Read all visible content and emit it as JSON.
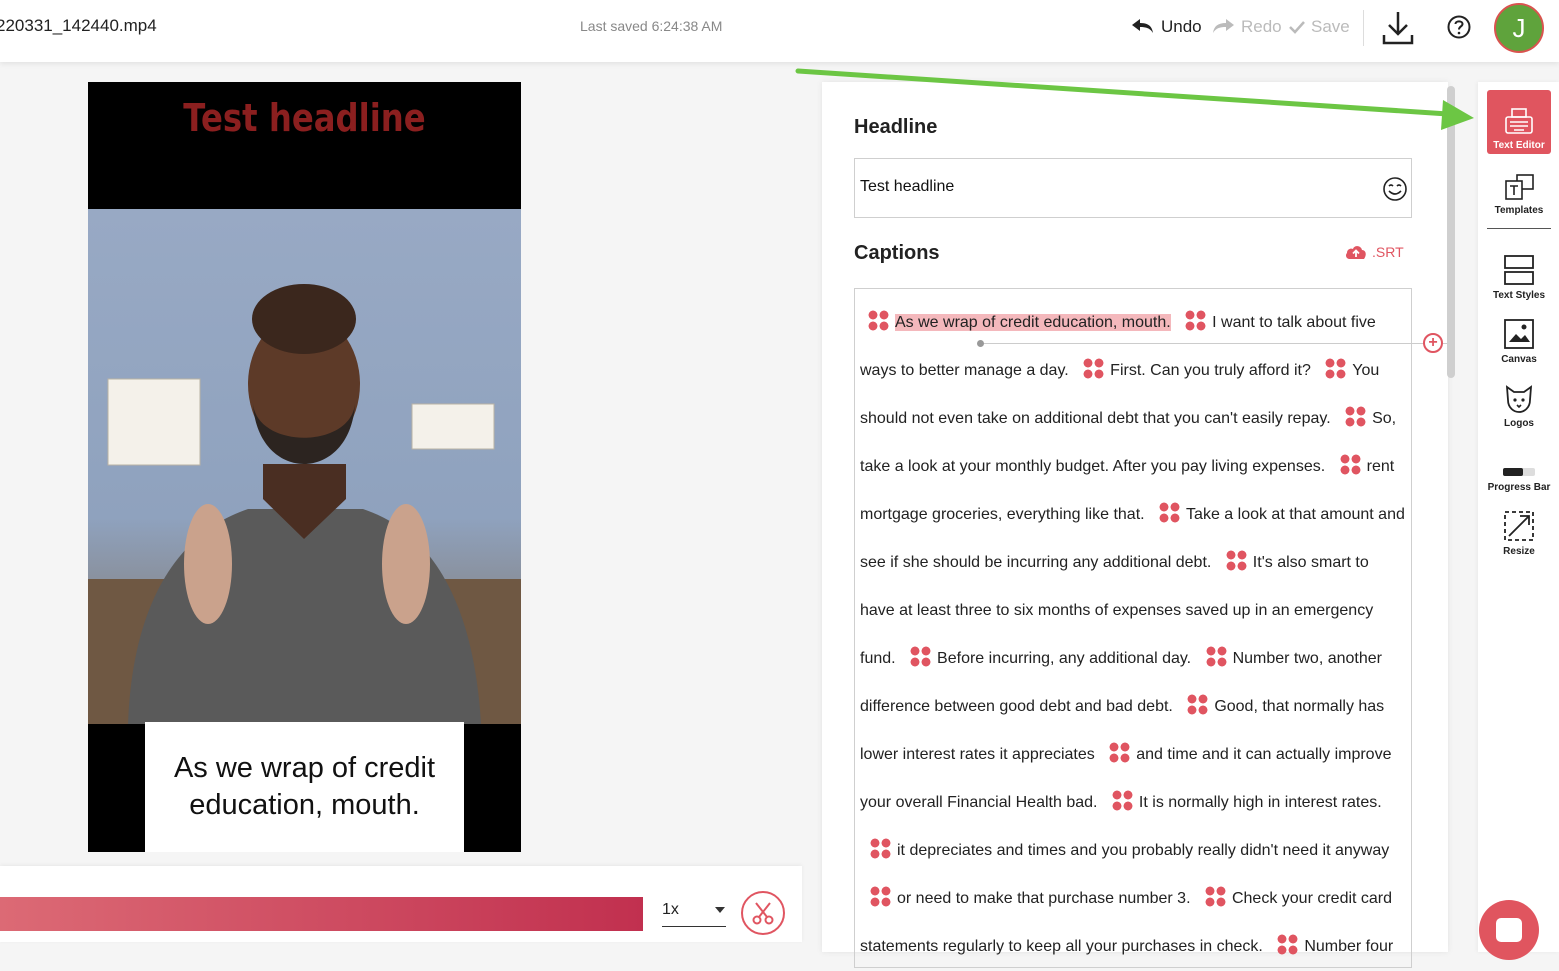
{
  "header": {
    "filename": "220331_142440.mp4",
    "last_saved": "Last saved 6:24:38 AM",
    "undo_label": "Undo",
    "redo_label": "Redo",
    "save_label": "Save",
    "avatar_initial": "J"
  },
  "video": {
    "headline": "Test headline",
    "caption_line1": "As we wrap of credit",
    "caption_line2": "education, mouth."
  },
  "playback": {
    "speed": "1x",
    "progress": 0.8
  },
  "editor": {
    "headline_label": "Headline",
    "headline_value": "Test headline",
    "captions_label": "Captions",
    "srt_label": ".SRT",
    "captions": [
      "As we wrap of credit education, mouth.",
      "I want to talk about five ways to better manage a day.",
      "First. Can you truly afford it?",
      "You should not even take on additional debt that you can't easily repay.",
      "So, take a look at your monthly budget. After you pay living expenses.",
      "rent mortgage groceries, everything like that.",
      "Take a look at that amount and see if she should be incurring any additional debt.",
      "It's also smart to have at least three to six months of expenses saved up in an emergency fund.",
      "Before incurring, any additional day.",
      "Number two, another difference between good debt and bad debt.",
      "Good, that normally has lower interest rates it appreciates",
      "and time and it can actually improve your overall Financial Health bad.",
      "It is normally high in interest rates.",
      "it depreciates and times and you probably really didn't need it anyway",
      "or need to make that purchase number 3.",
      "Check your credit card statements regularly to keep all your purchases in check.",
      "Number four"
    ]
  },
  "sidebar": {
    "items": [
      {
        "label": "Text Editor",
        "icon": "typewriter-icon",
        "active": true
      },
      {
        "label": "Templates",
        "icon": "templates-icon"
      },
      {
        "label": "Text Styles",
        "icon": "text-styles-icon"
      },
      {
        "label": "Canvas",
        "icon": "canvas-icon"
      },
      {
        "label": "Logos",
        "icon": "logos-icon"
      },
      {
        "label": "Progress Bar",
        "icon": "progress-bar-icon"
      },
      {
        "label": "Resize",
        "icon": "resize-icon"
      }
    ]
  },
  "colors": {
    "accent": "#e0555f",
    "annotation_arrow": "#6cc644",
    "avatar": "#5fa33c"
  }
}
